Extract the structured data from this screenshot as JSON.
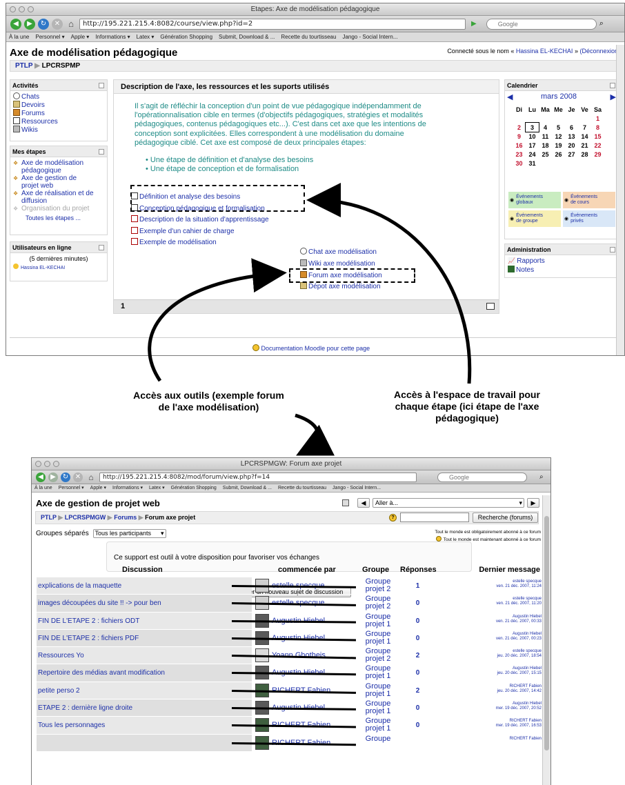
{
  "top_window": {
    "window_title": "Etapes: Axe de modélisation pédagogique",
    "url": "http://195.221.215.4:8082/course/view.php?id=2",
    "search_placeholder": "Google",
    "bookmarks": [
      "À la une",
      "Personnel ▾",
      "Apple ▾",
      "Informations ▾",
      "Latex ▾",
      "Génération Shopping",
      "Submit, Download & ...",
      "Recette du tourtisseau",
      "Jango - Social Intern..."
    ],
    "page_title": "Axe de modélisation pédagogique",
    "login": {
      "prefix": "Connecté sous le nom «",
      "user": "Hassina EL-KECHAI",
      "suffix": "»",
      "logout": "(Déconnexion)"
    },
    "breadcrumb": [
      "PTLP",
      "LPCRSPMP"
    ],
    "activities": {
      "title": "Activités",
      "items": [
        "Chats",
        "Devoirs",
        "Forums",
        "Ressources",
        "Wikis"
      ]
    },
    "mes_etapes": {
      "title": "Mes étapes",
      "items": [
        {
          "label": "Axe de modélisation pédagogique",
          "lines": [
            "Axe de modélisation",
            "pédagogique"
          ]
        },
        {
          "label": "Axe de gestion de projet web",
          "lines": [
            "Axe de gestion de",
            "projet web"
          ]
        },
        {
          "label": "Axe de réalisation et de diffusion",
          "lines": [
            "Axe de réalisation et de",
            "diffusion"
          ]
        }
      ],
      "dimmed": "Organisation du projet",
      "all": "Toutes les étapes ..."
    },
    "online": {
      "title": "Utilisateurs en ligne",
      "subtitle": "(5 dernières minutes)",
      "user": "Hassina EL-KECHAI"
    },
    "main": {
      "heading": "Description de l'axe, les ressources et les suports utilisés",
      "paragraph_lines": [
        "Il s'agit de réfléchir la conception d'un point de vue pédagogique indépendamment de",
        "l'opérationnalisation cible en termes (d'objectifs pédagogiques, stratégies et modalités",
        "pédagogiques, contenus pédagogiques etc...). C'est dans cet axe que les intentions de",
        "conception sont explicitées. Elles correspondent à une modélisation du domaine",
        "pédagogique ciblé. Cet axe est composé de deux principales étapes:"
      ],
      "bullets": [
        "Une étape de définition et d'analyse des besoins",
        "Une étape de conception et de formalisation"
      ],
      "resources": [
        "Définition et analyse des besoins",
        "Conception pédagogique et formalisation",
        "Description de la situation d'apprentissage",
        "Exemple d'un cahier de charge",
        "Exemple de modélisation"
      ],
      "tools": [
        "Chat axe modélisation",
        "Wiki axe modélisation",
        "Forum axe modélisation",
        "Dépot axe modélisation"
      ],
      "section_number": "1"
    },
    "calendar": {
      "title": "Calendrier",
      "month": "mars 2008",
      "weekdays": [
        "Di",
        "Lu",
        "Ma",
        "Me",
        "Je",
        "Ve",
        "Sa"
      ],
      "weeks": [
        [
          "",
          "",
          "",
          "",
          "",
          "",
          "1"
        ],
        [
          "2",
          "3",
          "4",
          "5",
          "6",
          "7",
          "8"
        ],
        [
          "9",
          "10",
          "11",
          "12",
          "13",
          "14",
          "15"
        ],
        [
          "16",
          "17",
          "18",
          "19",
          "20",
          "21",
          "22"
        ],
        [
          "23",
          "24",
          "25",
          "26",
          "27",
          "28",
          "29"
        ],
        [
          "30",
          "31",
          "",
          "",
          "",
          "",
          ""
        ]
      ],
      "today": "3",
      "legend": [
        {
          "lines": [
            "Événements",
            "globaux"
          ],
          "color": "#c9ecc0"
        },
        {
          "lines": [
            "Événements",
            "de cours"
          ],
          "color": "#f7d6b5"
        },
        {
          "lines": [
            "Événements",
            "de groupe"
          ],
          "color": "#f7efb3"
        },
        {
          "lines": [
            "Événements",
            "privés"
          ],
          "color": "#d9e7f7"
        }
      ]
    },
    "admin": {
      "title": "Administration",
      "items": [
        "Rapports",
        "Notes"
      ]
    },
    "footer_doc": "Documentation Moodle pour cette page"
  },
  "annotations": {
    "left_lines": [
      "Accès aux outils (exemple forum",
      "de l'axe modélisation)"
    ],
    "right_lines": [
      "Accès à l'espace de travail pour",
      "chaque étape (ici étape de l'axe",
      "pédagogique)"
    ]
  },
  "bottom_window": {
    "window_title": "LPCRSPMGW: Forum axe projet",
    "url": "http://195.221.215.4:8082/mod/forum/view.php?f=14",
    "search_placeholder": "Google",
    "bookmarks": [
      "À la une",
      "Personnel ▾",
      "Apple ▾",
      "Informations ▾",
      "Latex ▾",
      "Génération Shopping",
      "Submit, Download & ...",
      "Recette du tourtisseau",
      "Jango - Social Intern..."
    ],
    "page_title": "Axe de gestion de projet web",
    "jump_label": "Aller à...",
    "breadcrumb": [
      "PTLP",
      "LPCRSPMGW",
      "Forums",
      "Forum axe projet"
    ],
    "search_button": "Recherche (forums)",
    "groups_label": "Groupes séparés",
    "groups_value": "Tous les participants",
    "subscribe_1": "Tout le monde est obligatoirement abonné à ce forum",
    "subscribe_2": "Tout le monde est maintenant abonné à ce forum",
    "intro": "Ce support est outil à votre disposition pour favoriser vos échanges",
    "add_button": "Ajouter un nouveau sujet de discussion",
    "columns": [
      "Discussion",
      "commencée par",
      "Groupe",
      "Réponses",
      "Dernier message"
    ],
    "rows": [
      {
        "title": "explications de la maquette",
        "author": "estelle specque",
        "group": [
          "Groupe",
          "projet 2"
        ],
        "replies": "1",
        "last": [
          "estelle specque",
          "ven. 21 déc. 2007, 11:24"
        ]
      },
      {
        "title": "images découpées du site !! -> pour ben",
        "author": "estelle specque",
        "group": [
          "Groupe",
          "projet 2"
        ],
        "replies": "0",
        "last": [
          "estelle specque",
          "ven. 21 déc. 2007, 11:20"
        ]
      },
      {
        "title": "FIN DE L'ETAPE 2 : fichiers ODT",
        "author": "Augustin Hiebel",
        "group": [
          "Groupe",
          "projet 1"
        ],
        "replies": "0",
        "last": [
          "Augustin Hiebel",
          "ven. 21 déc. 2007, 00:33"
        ]
      },
      {
        "title": "FIN DE L'ETAPE 2 : fichiers PDF",
        "author": "Augustin Hiebel",
        "group": [
          "Groupe",
          "projet 1"
        ],
        "replies": "0",
        "last": [
          "Augustin Hiebel",
          "ven. 21 déc. 2007, 00:23"
        ]
      },
      {
        "title": "Ressources Yo",
        "author": "Yoann Ghotheis",
        "group": [
          "Groupe",
          "projet 2"
        ],
        "replies": "2",
        "last": [
          "estelle specque",
          "jeu. 20 déc. 2007, 18:54"
        ]
      },
      {
        "title": "Repertoire des médias avant modification",
        "author": "Augustin Hiebel",
        "group": [
          "Groupe",
          "projet 1"
        ],
        "replies": "0",
        "last": [
          "Augustin Hiebel",
          "jeu. 20 déc. 2007, 15:15"
        ]
      },
      {
        "title": "petite perso 2",
        "author": "RICHERT Fabien",
        "group": [
          "Groupe",
          "projet 1"
        ],
        "replies": "2",
        "last": [
          "RICHERT Fabien",
          "jeu. 20 déc. 2007, 14:42"
        ]
      },
      {
        "title": "ETAPE 2 : dernière ligne droite",
        "author": "Augustin Hiebel",
        "group": [
          "Groupe",
          "projet 1"
        ],
        "replies": "0",
        "last": [
          "Augustin Hiebel",
          "mer. 19 déc. 2007, 20:52"
        ]
      },
      {
        "title": "Tous les personnages",
        "author": "RICHERT Fabien",
        "group": [
          "Groupe",
          "projet 1"
        ],
        "replies": "0",
        "last": [
          "RICHERT Fabien",
          "mer. 19 déc. 2007, 16:53"
        ]
      },
      {
        "title": "",
        "author": "RICHERT Fabien",
        "group": [
          "Groupe",
          ""
        ],
        "replies": "",
        "last": [
          "RICHERT Fabien",
          ""
        ]
      }
    ]
  }
}
